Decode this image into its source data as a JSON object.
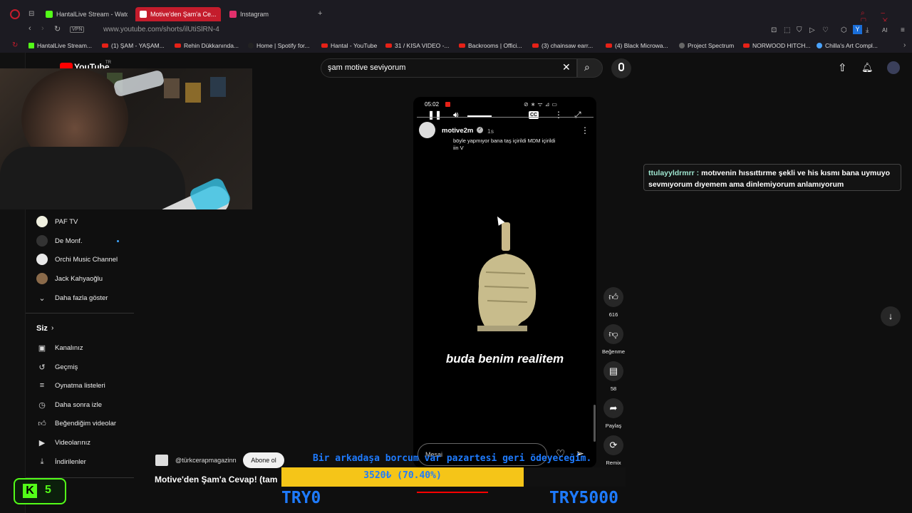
{
  "browser": {
    "tabs": [
      {
        "label": "HantalLive Stream - Watch",
        "fav": "#53fc18"
      },
      {
        "label": "Motive'den Şam'a Ce...",
        "fav": "#ff0000"
      },
      {
        "label": "Instagram",
        "fav": "#e1306c"
      }
    ],
    "url": "www.youtube.com/shorts/ilUtiSlRN-4",
    "vpn_label": "VPN",
    "ai_label": "AI",
    "bookmarks": [
      "HantalLive Stream...",
      "(1) ŞAM - YAŞAM...",
      "Rehin Dükkanında...",
      "Home | Spotify for...",
      "Hantal - YouTube",
      "31 / KISA VIDEO -...",
      "Backrooms | Offici...",
      "(3) chainsaw earr...",
      "(4) Black Microwa...",
      "Project Spectrum",
      "NORWOOD HITCH...",
      "Chilla's Art Compl..."
    ]
  },
  "youtube": {
    "logo_text": "YouTube",
    "logo_sup": "TR",
    "search_value": "şam motive seviyorum"
  },
  "sidebar": {
    "subscriptions": [
      {
        "label": "PAF TV"
      },
      {
        "label": "De Monf."
      },
      {
        "label": "Orchi Music Channel"
      },
      {
        "label": "Jack Kahyaoğlu"
      }
    ],
    "show_more": "Daha fazla göster",
    "you_header": "Siz",
    "you_items": [
      {
        "label": "Kanalınız",
        "icon": "channel-icon"
      },
      {
        "label": "Geçmiş",
        "icon": "history-icon"
      },
      {
        "label": "Oynatma listeleri",
        "icon": "playlist-icon"
      },
      {
        "label": "Daha sonra izle",
        "icon": "clock-icon"
      },
      {
        "label": "Beğendiğim videolar",
        "icon": "like-icon"
      },
      {
        "label": "Videolarınız",
        "icon": "video-icon"
      },
      {
        "label": "İndirilenler",
        "icon": "download-icon"
      }
    ]
  },
  "short": {
    "phone_time": "05:02",
    "cc_label": "CC",
    "channel": "motive2m",
    "age": "1s",
    "caption": "böyle yapmıyor bana taş içirildi MDM içirildi iin V",
    "overlay_text": "buda benim realitem",
    "message_placeholder": "Mesai",
    "likes": "616",
    "dislike_label": "Beğenme",
    "comments": "58",
    "share_label": "Paylaş",
    "remix_label": "Remix"
  },
  "chat": {
    "user": "ttulayyldrmrr :",
    "message": "motıvenin hıssıttırme şekli ve his kısmı bana uymuyo sevmıyorum dıyemem ama dinlemiyorum anlamıyorum"
  },
  "video_info": {
    "channel": "@türkcerapmagazinn",
    "subscribe": "Abone ol",
    "title": "Motive'den Şam'a Cevap! (tam"
  },
  "donation": {
    "message": "Bir arkadaşa borcum var pazartesi geri ödeyeceğim.",
    "goal_text": "3520₺ (70.40%)",
    "goal_fraction": 0.704,
    "min_label": "TRY0",
    "max_label": "TRY5000"
  },
  "kick": {
    "logo": "K",
    "viewers": "5"
  },
  "colors": {
    "accent_red": "#c41c2c",
    "kick_green": "#53fc18",
    "goal_yellow": "#f5c518",
    "overlay_blue": "#1e7bff"
  }
}
